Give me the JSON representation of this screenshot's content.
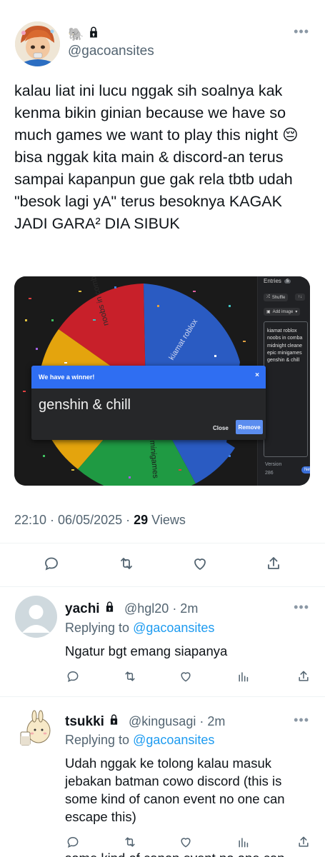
{
  "tweet": {
    "handle": "@gacoansites",
    "name_emojis": "🐘",
    "text": "kalau liat ini lucu nggak sih soalnya kak kenma bikin ginian because we have so much games we want to play this night 😔 bisa nggak kita main & discord-an terus sampai kapanpun gue gak rela tbtb udah \"besok lagi yA\" terus besoknya KAGAK JADI GARA² DIA SIBUK",
    "time": "22:10 · 06/05/2025 · ",
    "views_count": "29",
    "views_label": " Views"
  },
  "media": {
    "wheel_labels": [
      "noobs in combat",
      "kiamat roblox",
      "minigames"
    ],
    "entries_title": "Entries",
    "entries_count": "5",
    "shuffle_label": "Shuffle",
    "sort_label": "↑↓",
    "add_image_label": "Add image",
    "entries": [
      "kiamat roblox",
      "noobs in comba",
      "midnight cleane",
      "epic minigames",
      "genshin & chill"
    ],
    "version_label": "Version",
    "version_number": "286",
    "new_label": "New",
    "dialog_title": "We have a winner!",
    "dialog_close_x": "×",
    "winner": "genshin & chill",
    "close_label": "Close",
    "remove_label": "Remove"
  },
  "replies": [
    {
      "name": "yachi",
      "handle": "@hgl20 · 2m",
      "replying_prefix": "Replying to ",
      "replying_to": "@gacoansites",
      "text": "Ngatur bgt emang siapanya"
    },
    {
      "name": "tsukki",
      "handle": "@kingusagi · 2m",
      "replying_prefix": "Replying to ",
      "replying_to": "@gacoansites",
      "text_lines": [
        "Udah nggak ke tolong kalau masuk",
        "jebakan batman cowo discord (this is",
        "some kind of canon event no one can",
        "escape this)"
      ],
      "cutoff_text": "some kind of canon event no one can"
    }
  ],
  "colors": {
    "accent": "#1d9bf0",
    "muted": "#536471",
    "wheel_red": "#c8202a",
    "wheel_blue": "#2a5bc2",
    "wheel_green": "#1f9a43",
    "wheel_yellow": "#e4a40d",
    "dialog_blue": "#2f6ef2"
  }
}
